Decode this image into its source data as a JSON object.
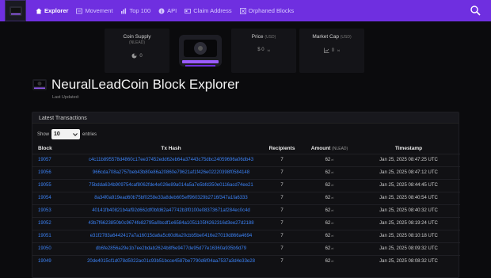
{
  "nav": {
    "items": [
      {
        "label": "Explorer",
        "icon": "home-icon"
      },
      {
        "label": "Movement",
        "icon": "movement-icon"
      },
      {
        "label": "Top 100",
        "icon": "chart-icon"
      },
      {
        "label": "API",
        "icon": "info-icon"
      },
      {
        "label": "Claim Address",
        "icon": "claim-icon"
      },
      {
        "label": "Orphaned Blocks",
        "icon": "orphan-icon"
      }
    ]
  },
  "stats": {
    "coin_supply": {
      "label": "Coin Supply",
      "sub": "(NLEAD)",
      "value": "0"
    },
    "price": {
      "label": "Price",
      "sub": "(USD)",
      "value": "$ 0",
      "unit": "hi"
    },
    "market_cap": {
      "label": "Market Cap",
      "sub": "(USD)",
      "value": "0",
      "unit": "hi"
    }
  },
  "page": {
    "title": "NeuralLeadCoin Block Explorer",
    "subtitle": "Last Updated:"
  },
  "transactions": {
    "header": "Latest Transactions",
    "show_label": "Show",
    "entries_value": "10",
    "entries_label": "entries",
    "columns": {
      "block": "Block",
      "hash": "Tx Hash",
      "recipients": "Recipients",
      "amount": "Amount",
      "amount_unit": "(NLEAD)",
      "timestamp": "Timestamp"
    },
    "rows": [
      {
        "block": "19057",
        "hash": "c4c11b895578d4860c17ee37452edd62eb64a37443c75dbc24059696a06db43",
        "recipients": "7",
        "amount": "62",
        "unit": "ei",
        "timestamp": "Jan 25, 2025 08:47:25 UTC"
      },
      {
        "block": "19056",
        "hash": "966cda708a2757beb43b80e86a20860e79621af1f426e02220398f0584148",
        "recipients": "7",
        "amount": "62",
        "unit": "ei",
        "timestamp": "Jan 25, 2025 08:47:12 UTC"
      },
      {
        "block": "19055",
        "hash": "75bdda634b909754caf8062fde4e026e89a014a5a7e5bfd350e0116acd74ee21",
        "recipients": "7",
        "amount": "62",
        "unit": "ei",
        "timestamp": "Jan 25, 2025 08:44:45 UTC"
      },
      {
        "block": "19054",
        "hash": "8a34f0a919ead60b75bf0258e33a8deb605eff960329b2716f347a1fa6333",
        "recipients": "7",
        "amount": "62",
        "unit": "ei",
        "timestamp": "Jan 25, 2025 08:40:54 UTC"
      },
      {
        "block": "19053",
        "hash": "40141fb40821b4af92d662df0bfd62a47742b3f0100e08373671af284ec0c4d",
        "recipients": "7",
        "amount": "62",
        "unit": "ei",
        "timestamp": "Jan 25, 2025 08:40:32 UTC"
      },
      {
        "block": "19052",
        "hash": "43b7f6623850b0c9674fe82795a0bcdf1e6584a1051105f4262316d3ee27d2188",
        "recipients": "7",
        "amount": "62",
        "unit": "ei",
        "timestamp": "Jan 25, 2025 08:19:24 UTC"
      },
      {
        "block": "19051",
        "hash": "e31f2783a6442417a7a16015da6a5c60d6a20cbb5be0416e27019d866a4694",
        "recipients": "7",
        "amount": "62",
        "unit": "ei",
        "timestamp": "Jan 25, 2025 08:10:18 UTC"
      },
      {
        "block": "19050",
        "hash": "db6fe2856a29e1b7ee2bdab2624b8f6e9477de95d77e16360a935b9d79",
        "recipients": "7",
        "amount": "62",
        "unit": "ei",
        "timestamp": "Jan 25, 2025 08:09:32 UTC"
      },
      {
        "block": "19049",
        "hash": "20de4015cf1d078d5022ac01c93b51bcce4587be7790d6f04aa7537a3d4e33e28",
        "recipients": "7",
        "amount": "62",
        "unit": "ei",
        "timestamp": "Jan 25, 2025 08:08:32 UTC"
      }
    ]
  },
  "colors": {
    "navbar": "#6f2fe0",
    "link": "#3b82f6",
    "background": "#0b0b0d"
  }
}
